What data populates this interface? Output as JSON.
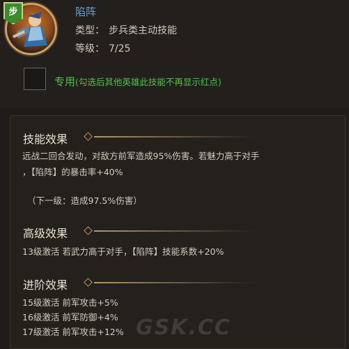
{
  "header": {
    "type_badge": "步",
    "skill_name": "陷阵",
    "type_label": "类型：",
    "type_value": "步兵类主动技能",
    "level_label": "等级：",
    "level_value": "7/25",
    "exclusive_main": "专用",
    "exclusive_note": "(勾选后其他英雄此技能不再显示红点)"
  },
  "sections": {
    "effect": {
      "title": "技能效果",
      "line1": "远战二回合发动，对敌方前军造成95%伤害。若魅力高于对手",
      "line2": "，【陷阵】的暴击率+40%",
      "next": "（下一级：造成97.5%伤害）"
    },
    "advanced": {
      "title": "高级效果",
      "line1": "13级激活  若武力高于对手，【陷阵】技能系数+20%"
    },
    "promote": {
      "title": "进阶效果",
      "items": [
        "15级激活  前军攻击+5%",
        "16级激活  前军防御+4%",
        "17级激活  前军攻击+12%"
      ]
    }
  },
  "watermark": "GSK.CC",
  "colors": {
    "name_blue": "#5aa7e6",
    "green": "#4ec14a",
    "accent_gold": "#b79667"
  }
}
